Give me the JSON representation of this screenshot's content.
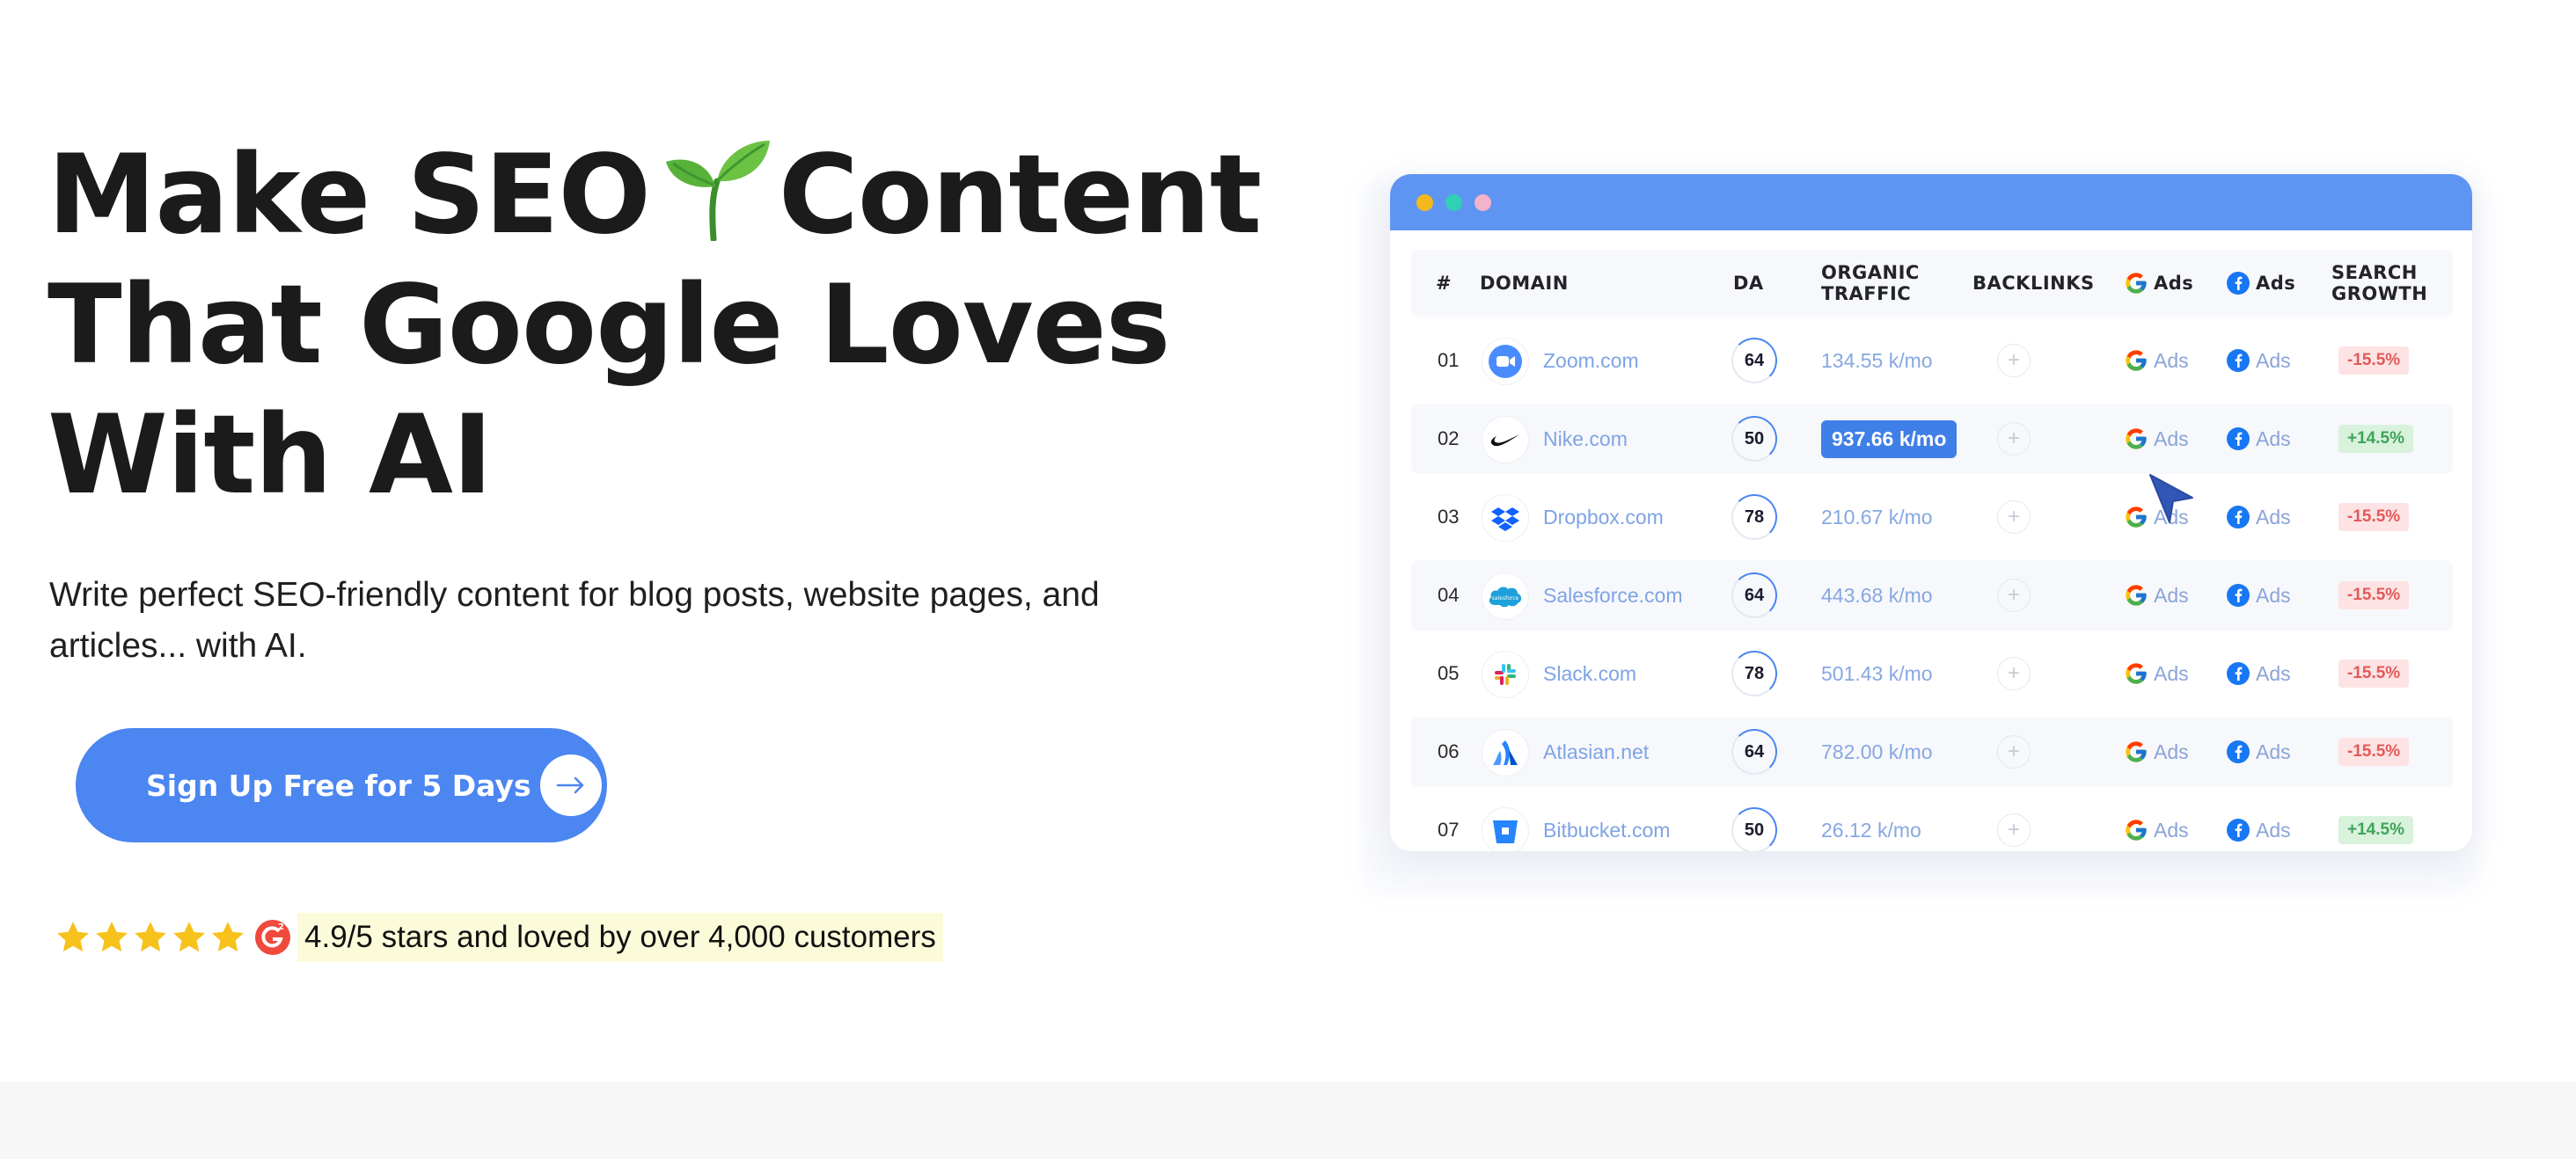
{
  "hero": {
    "title_line1_a": "Make SEO",
    "title_line1_b": "Content",
    "title_line2": "That Google Loves",
    "title_line3": "With AI",
    "subtitle": "Write perfect SEO-friendly content for blog posts, website pages, and articles... with AI.",
    "cta_label": "Sign Up Free for 5 Days",
    "rating_value": 4.9,
    "rating_max": 5,
    "rating_text": "4.9/5 stars and loved by over 4,000 customers"
  },
  "table": {
    "headers": {
      "num": "#",
      "domain": "DOMAIN",
      "da": "DA",
      "organic_l1": "ORGANIC",
      "organic_l2": "TRAFFIC",
      "backlinks": "BACKLINKS",
      "google_ads": "Ads",
      "facebook_ads": "Ads",
      "growth_l1": "SEARCH",
      "growth_l2": "GROWTH"
    },
    "rows": [
      {
        "num": "01",
        "domain": "Zoom.com",
        "da": "64",
        "traffic": "134.55 k/mo",
        "plus": "+",
        "gads": "Ads",
        "fads": "Ads",
        "growth": "-15.5%"
      },
      {
        "num": "02",
        "domain": "Nike.com",
        "da": "50",
        "traffic": "937.66 k/mo",
        "plus": "+",
        "gads": "Ads",
        "fads": "Ads",
        "growth": "+14.5%"
      },
      {
        "num": "03",
        "domain": "Dropbox.com",
        "da": "78",
        "traffic": "210.67 k/mo",
        "plus": "+",
        "gads": "Ads",
        "fads": "Ads",
        "growth": "-15.5%"
      },
      {
        "num": "04",
        "domain": "Salesforce.com",
        "da": "64",
        "traffic": "443.68 k/mo",
        "plus": "+",
        "gads": "Ads",
        "fads": "Ads",
        "growth": "-15.5%"
      },
      {
        "num": "05",
        "domain": "Slack.com",
        "da": "78",
        "traffic": "501.43 k/mo",
        "plus": "+",
        "gads": "Ads",
        "fads": "Ads",
        "growth": "-15.5%"
      },
      {
        "num": "06",
        "domain": "Atlasian.net",
        "da": "64",
        "traffic": "782.00 k/mo",
        "plus": "+",
        "gads": "Ads",
        "fads": "Ads",
        "growth": "-15.5%"
      },
      {
        "num": "07",
        "domain": "Bitbucket.com",
        "da": "50",
        "traffic": "26.12 k/mo",
        "plus": "+",
        "gads": "Ads",
        "fads": "Ads",
        "growth": "+14.5%"
      }
    ]
  },
  "colors": {
    "accent": "#4b86f1",
    "titlebar": "#5f95f2",
    "star": "#f6c21b",
    "rating_highlight": "#fbfbd9",
    "negative": "#e25a5a",
    "positive": "#3fa35a"
  },
  "icons": [
    "sprout-icon",
    "arrow-right-icon",
    "star-icon",
    "g2-icon",
    "google-icon",
    "facebook-icon",
    "cursor-icon"
  ]
}
